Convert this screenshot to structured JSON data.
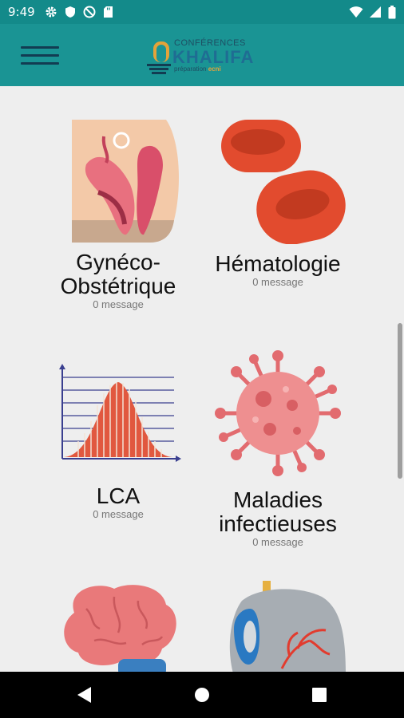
{
  "status_bar": {
    "time": "9:49",
    "icons_left": [
      "settings-icon",
      "shield-icon",
      "vpn-icon",
      "sd-card-icon"
    ],
    "icons_right": [
      "wifi-icon",
      "signal-icon",
      "battery-icon"
    ]
  },
  "app_bar": {
    "logo": {
      "top_text": "CONFÉRENCES",
      "main_text": "KHALIFA",
      "sub_text": "préparation",
      "sub_accent": "ecni"
    },
    "menu_icon": "hamburger-menu-icon"
  },
  "categories": [
    {
      "title": "Gynéco-\nObstétrique",
      "count": "0 message",
      "icon": "uterus-anatomy-icon"
    },
    {
      "title": "Hématologie",
      "count": "0 message",
      "icon": "red-blood-cells-icon"
    },
    {
      "title": "LCA",
      "count": "0 message",
      "icon": "bell-curve-chart-icon"
    },
    {
      "title": "Maladies\ninfectieuses",
      "count": "0 message",
      "icon": "virus-icon"
    },
    {
      "title": "",
      "count": "",
      "icon": "brain-icon"
    },
    {
      "title": "",
      "count": "",
      "icon": "eye-anatomy-icon"
    }
  ],
  "colors": {
    "status_bar": "#138a8a",
    "app_bar": "#1a9494",
    "background": "#eeeeee",
    "nav_bar": "#000000"
  },
  "nav_bar": {
    "back": "back-icon",
    "home": "home-icon",
    "recents": "recents-icon"
  }
}
